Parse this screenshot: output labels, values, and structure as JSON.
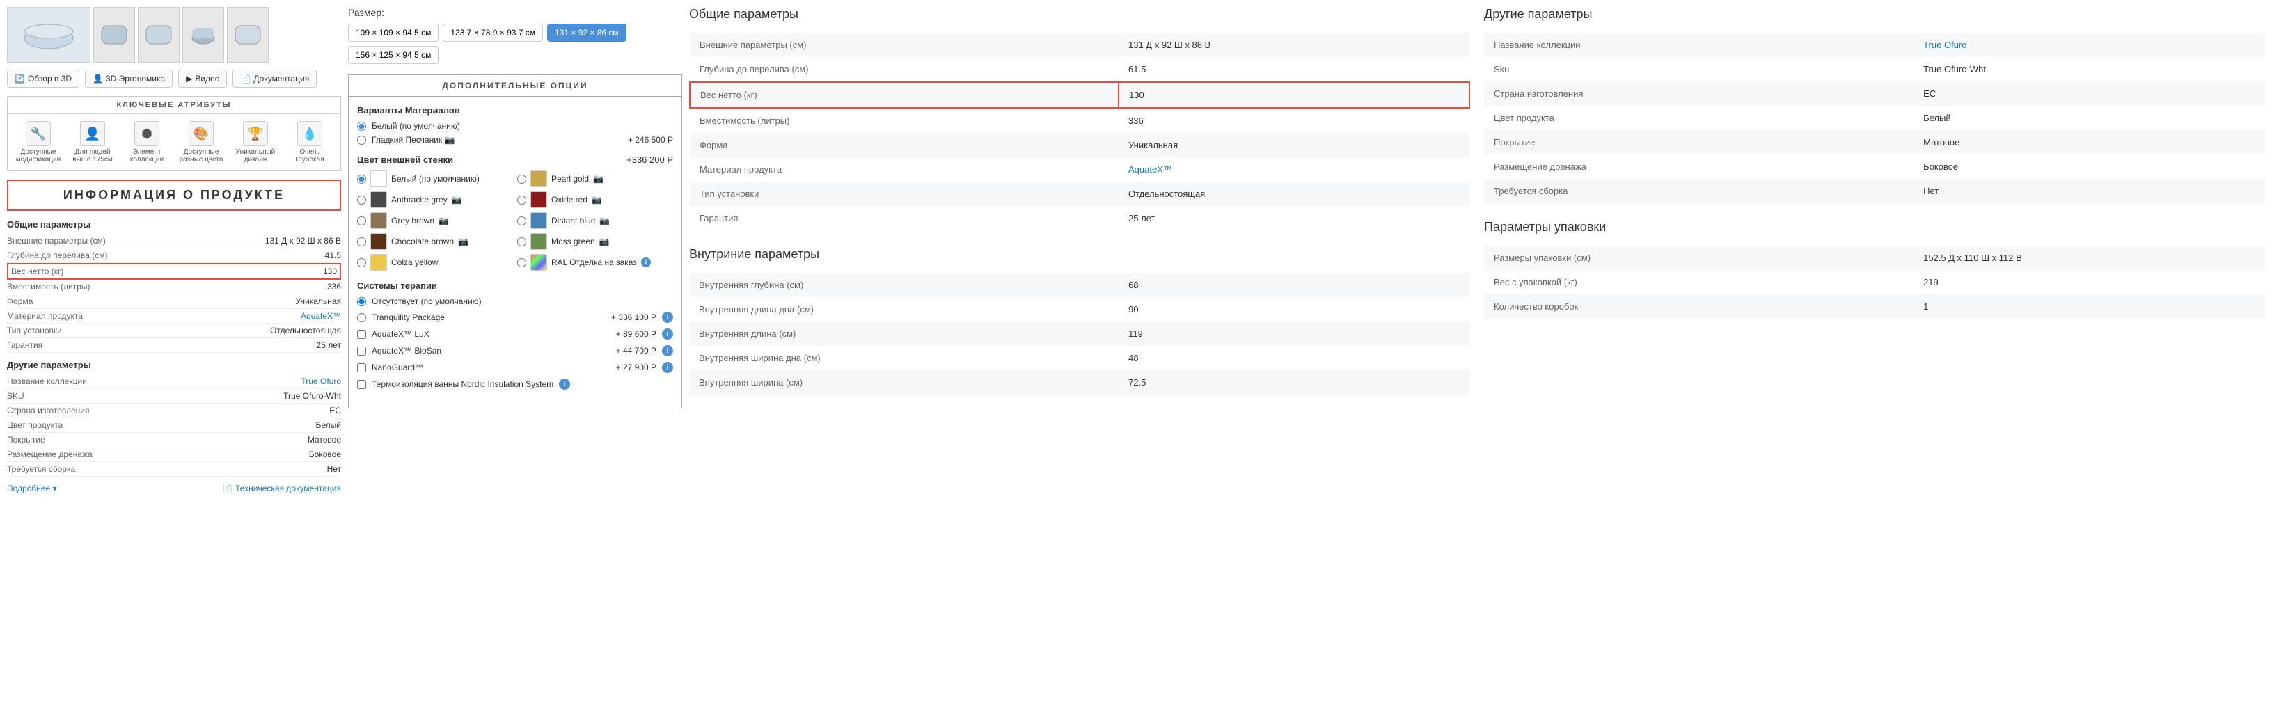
{
  "leftPanel": {
    "navButtons": [
      {
        "label": "Обзор в 3D",
        "icon": "🔄"
      },
      {
        "label": "3D Эргономика",
        "icon": "👤"
      },
      {
        "label": "Видео",
        "icon": "▶"
      },
      {
        "label": "Документация",
        "icon": "📄"
      }
    ],
    "keyAttributesTitle": "КЛЮЧЕВЫЕ АТРИБУТЫ",
    "attributes": [
      {
        "icon": "🔧",
        "label": "Доступные\nмодификации"
      },
      {
        "icon": "👤",
        "label": "Для людей\nвыше 175см"
      },
      {
        "icon": "⬢",
        "label": "Элемент\nколлекции"
      },
      {
        "icon": "🎨",
        "label": "Доступные\nразные цвета"
      },
      {
        "icon": "🏆",
        "label": "Уникальный\nдизайн"
      },
      {
        "icon": "💧",
        "label": "Очень\nглубокая"
      }
    ],
    "productInfoBanner": "ИНФОРМАЦИЯ О ПРОДУКТЕ",
    "generalParams": {
      "title": "Общие параметры",
      "rows": [
        {
          "label": "Внешние параметры (см)",
          "value": "131 Д х 92 Ш х 86 В",
          "highlighted": false
        },
        {
          "label": "Глубина до перелива (см)",
          "value": "41.5",
          "highlighted": false
        },
        {
          "label": "Вес нетто (кг)",
          "value": "130",
          "highlighted": true
        },
        {
          "label": "Вместимость (литры)",
          "value": "336",
          "highlighted": false
        },
        {
          "label": "Форма",
          "value": "Уникальная",
          "highlighted": false
        },
        {
          "label": "Материал продукта",
          "value": "AquateX™",
          "highlighted": false,
          "isLink": true
        },
        {
          "label": "Тип установки",
          "value": "Отдельностоящая",
          "highlighted": false
        },
        {
          "label": "Гарантия",
          "value": "25 лет",
          "highlighted": false
        }
      ]
    },
    "otherParams": {
      "title": "Другие параметры",
      "rows": [
        {
          "label": "Название коллекции",
          "value": "True Ofuro",
          "isLink": true
        },
        {
          "label": "SKU",
          "value": "True Ofuro-Wht"
        },
        {
          "label": "Страна изготовления",
          "value": "ЕС"
        },
        {
          "label": "Цвет продукта",
          "value": "Белый"
        },
        {
          "label": "Покрытие",
          "value": "Матовое"
        },
        {
          "label": "Размещение дренажа",
          "value": "Боковое"
        },
        {
          "label": "Требуется сборка",
          "value": "Нет"
        }
      ]
    },
    "bottomLinks": {
      "more": "Подробнее ▾",
      "docs": "Техническая документация"
    }
  },
  "middlePanel": {
    "sizeLabel": "Размер:",
    "sizes": [
      {
        "label": "109 × 109 × 94.5 см",
        "active": false
      },
      {
        "label": "123.7 × 78.9 × 93.7 см",
        "active": false
      },
      {
        "label": "131 × 92 × 86 см",
        "active": true
      },
      {
        "label": "156 × 125 × 94.5 см",
        "active": false
      }
    ],
    "additionalOptionsTitle": "ДОПОЛНИТЕЛЬНЫЕ ОПЦИИ",
    "materialSection": {
      "title": "Варианты Материалов",
      "options": [
        {
          "label": "Белый (по умолчанию)",
          "checked": true,
          "price": ""
        },
        {
          "label": "Гладкий Песчаник 📷",
          "checked": false,
          "price": "+ 246 500 Р"
        }
      ]
    },
    "colorSection": {
      "title": "Цвет внешней стенки",
      "headerPrice": "+336 200 Р",
      "colors": [
        {
          "label": "Белый (по умолчанию)",
          "swatch": "white",
          "checked": true,
          "camera": false
        },
        {
          "label": "Pearl gold",
          "swatch": "pearl-gold",
          "checked": false,
          "camera": true
        },
        {
          "label": "Anthracite grey",
          "swatch": "anthracite",
          "checked": false,
          "camera": true
        },
        {
          "label": "Oxide red",
          "swatch": "oxide-red",
          "checked": false,
          "camera": true
        },
        {
          "label": "Grey brown",
          "swatch": "grey-brown",
          "checked": false,
          "camera": true
        },
        {
          "label": "Distant blue",
          "swatch": "distant-blue",
          "checked": false,
          "camera": true
        },
        {
          "label": "Chocolate brown",
          "swatch": "chocolate",
          "checked": false,
          "camera": true
        },
        {
          "label": "Moss green",
          "swatch": "moss-green",
          "checked": false,
          "camera": true
        },
        {
          "label": "Colza yellow",
          "swatch": "colza-yellow",
          "checked": false,
          "camera": false
        },
        {
          "label": "RAL Отделка на заказ ℹ",
          "swatch": "ral",
          "checked": false,
          "camera": true
        }
      ]
    },
    "therapySection": {
      "title": "Системы терапии",
      "options": [
        {
          "label": "Отсутствует (по умолчанию)",
          "checked": true,
          "price": "",
          "isRadio": true
        },
        {
          "label": "Tranquility Package",
          "checked": false,
          "price": "+ 336 100 Р",
          "isRadio": true,
          "info": true
        },
        {
          "label": "AquateX™ LuX",
          "checked": false,
          "price": "+ 89 600 Р",
          "isCheckbox": true,
          "info": true
        },
        {
          "label": "AquateX™ BioSan",
          "checked": false,
          "price": "+ 44 700 Р",
          "isCheckbox": true,
          "info": true
        },
        {
          "label": "NanoGuard™",
          "checked": false,
          "price": "+ 27 900 Р",
          "isCheckbox": true,
          "info": true
        },
        {
          "label": "Термоизоляция ванны Nordic Insulation System",
          "checked": false,
          "price": "",
          "isCheckbox": true,
          "info": true
        }
      ]
    }
  },
  "rightSection": {
    "generalParams": {
      "title": "Общие параметры",
      "rows": [
        {
          "label": "Внешние параметры (см)",
          "value": "131 Д х 92 Ш х 86 В",
          "highlighted": false
        },
        {
          "label": "Глубина до перелива (см)",
          "value": "61.5",
          "highlighted": false
        },
        {
          "label": "Вес нетто (кг)",
          "value": "130",
          "highlighted": true
        },
        {
          "label": "Вместимость (литры)",
          "value": "336",
          "highlighted": false
        },
        {
          "label": "Форма",
          "value": "Уникальная",
          "highlighted": false
        },
        {
          "label": "Материал продукта",
          "value": "AquateX™",
          "highlighted": false,
          "isLink": true
        },
        {
          "label": "Тип установки",
          "value": "Отдельностоящая",
          "highlighted": false
        },
        {
          "label": "Гарантия",
          "value": "25 лет",
          "highlighted": false
        }
      ]
    },
    "internalParams": {
      "title": "Внутриние параметры",
      "rows": [
        {
          "label": "Внутренняя глубина (см)",
          "value": "68"
        },
        {
          "label": "Внутренняя длина дна (см)",
          "value": "90"
        },
        {
          "label": "Внутренняя длина (см)",
          "value": "119"
        },
        {
          "label": "Внутренняя ширина дна (см)",
          "value": "48"
        },
        {
          "label": "Внутренняя ширина (см)",
          "value": "72.5"
        }
      ]
    },
    "otherParams": {
      "title": "Другие параметры",
      "rows": [
        {
          "label": "Название коллекции",
          "value": "True Ofuro",
          "isLink": true
        },
        {
          "label": "Sku",
          "value": "True Ofuro-Wht"
        },
        {
          "label": "Страна изготовления",
          "value": "ЕС"
        },
        {
          "label": "Цвет продукта",
          "value": "Белый"
        },
        {
          "label": "Покрытие",
          "value": "Матовое"
        },
        {
          "label": "Размещение дренажа",
          "value": "Боковое"
        },
        {
          "label": "Требуется сборка",
          "value": "Нет"
        }
      ]
    },
    "packagingParams": {
      "title": "Параметры упаковки",
      "rows": [
        {
          "label": "Размеры упаковки (см)",
          "value": "152.5 Д х 110 Ш х 112 В"
        },
        {
          "label": "Вес с упаковкой (кг)",
          "value": "219"
        },
        {
          "label": "Количество коробок",
          "value": "1"
        }
      ]
    }
  }
}
